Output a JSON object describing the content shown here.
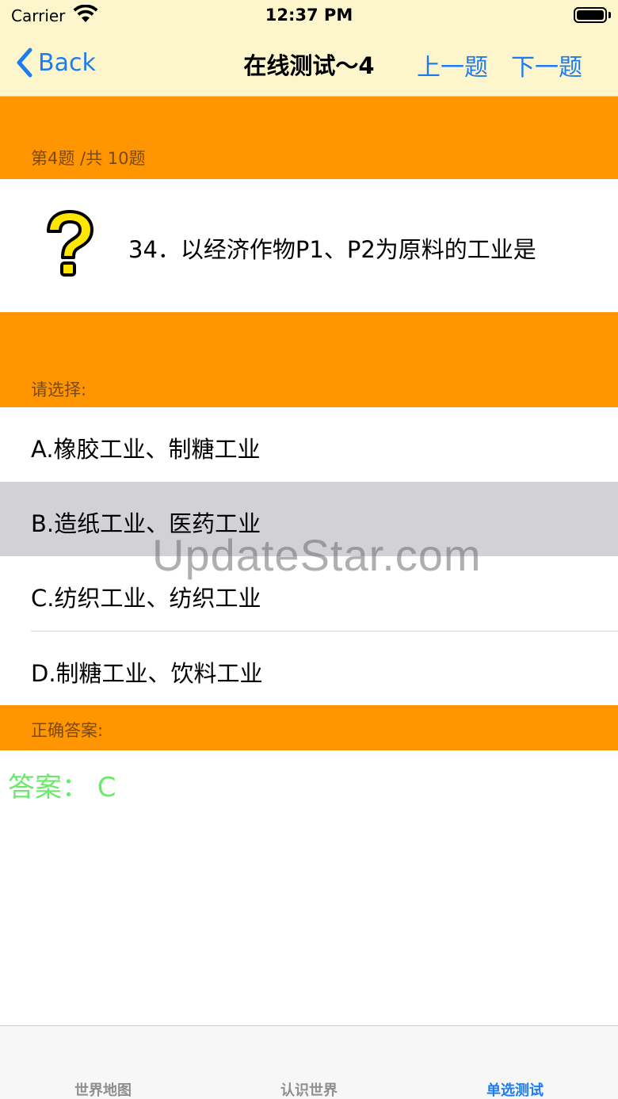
{
  "status_bar": {
    "carrier": "Carrier",
    "time": "12:37 PM"
  },
  "nav": {
    "back_label": "Back",
    "title": "在线测试～4",
    "prev_label": "上一题",
    "next_label": "下一题"
  },
  "progress": {
    "label": "第4题 /共 10题"
  },
  "question": {
    "icon": "question-mark-icon",
    "text": "34．以经济作物P1、P2为原料的工业是"
  },
  "choose": {
    "label": "请选择:"
  },
  "options": [
    {
      "text": "A.橡胶工业、制糖工业",
      "selected": false
    },
    {
      "text": "B.造纸工业、医药工业",
      "selected": true
    },
    {
      "text": "C.纺织工业、纺织工业",
      "selected": false
    },
    {
      "text": "D.制糖工业、饮料工业",
      "selected": false
    }
  ],
  "correct": {
    "label": "正确答案:",
    "answer": "答案： C"
  },
  "watermark": "UpdateStar.com",
  "tabs": [
    {
      "label": "世界地图",
      "active": false
    },
    {
      "label": "认识世界",
      "active": false
    },
    {
      "label": "单选测试",
      "active": true
    }
  ],
  "colors": {
    "accent": "#1e7cf2",
    "header": "#ff9500",
    "nav_bg": "#fdf6cc",
    "answer": "#6ce86a",
    "selected_row": "#d1d1d6"
  }
}
